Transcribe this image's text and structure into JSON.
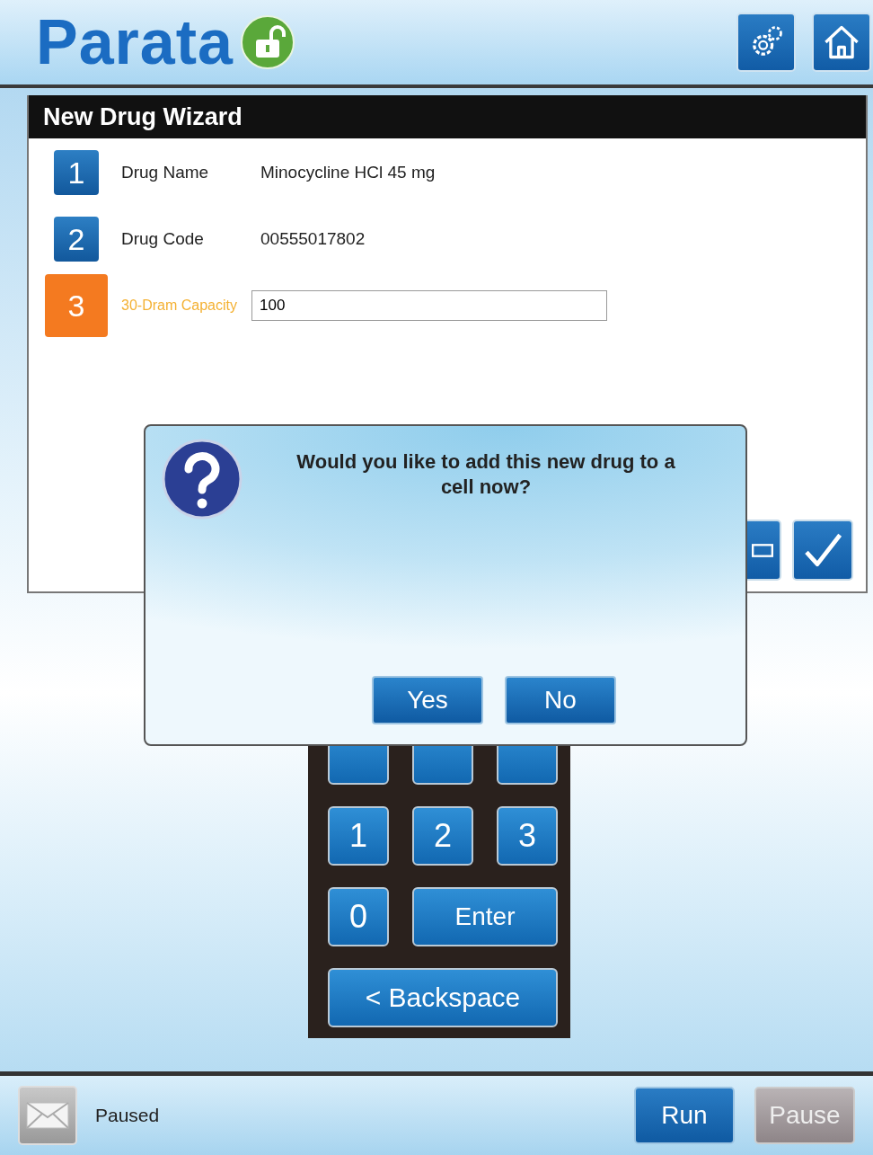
{
  "header": {
    "logo": "Parata",
    "unlocked": true
  },
  "wizard": {
    "title": "New Drug Wizard",
    "steps": [
      {
        "number": "1",
        "label": "Drug Name",
        "value": "Minocycline HCl 45 mg",
        "selected": false
      },
      {
        "number": "2",
        "label": "Drug Code",
        "value": "00555017802",
        "selected": false
      },
      {
        "number": "3",
        "label": "30-Dram Capacity",
        "input": "100",
        "selected": true
      }
    ]
  },
  "keypad": {
    "keys": [
      {
        "label": "1"
      },
      {
        "label": "2"
      },
      {
        "label": "3"
      },
      {
        "label": "0"
      },
      {
        "label": "Enter",
        "kind": "wide"
      },
      {
        "label": "< Backspace",
        "kind": "full"
      }
    ]
  },
  "dialog": {
    "message": "Would you like to add this new drug to a cell now?",
    "buttons": [
      "Yes",
      "No"
    ]
  },
  "status_bar": {
    "status": "Paused",
    "buttons": [
      {
        "label": "Run",
        "disabled": false
      },
      {
        "label": "Pause",
        "disabled": true
      }
    ]
  }
}
